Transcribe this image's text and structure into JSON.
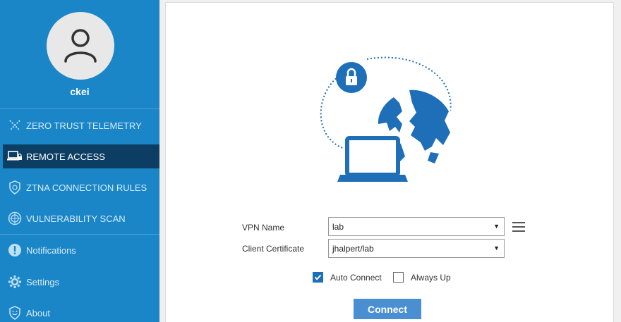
{
  "user": {
    "name": "ckei"
  },
  "nav": {
    "items": [
      {
        "label": "ZERO TRUST TELEMETRY",
        "icon": "telemetry-icon"
      },
      {
        "label": "REMOTE ACCESS",
        "icon": "laptop-lock-icon",
        "active": true
      },
      {
        "label": "ZTNA CONNECTION RULES",
        "icon": "shield-fingerprint-icon"
      },
      {
        "label": "VULNERABILITY SCAN",
        "icon": "radar-icon"
      },
      {
        "label": "Notifications",
        "icon": "exclamation-icon"
      },
      {
        "label": "Settings",
        "icon": "gear-icon"
      },
      {
        "label": "About",
        "icon": "shield-smile-icon"
      }
    ]
  },
  "form": {
    "vpn_name_label": "VPN Name",
    "vpn_name_value": "lab",
    "client_cert_label": "Client Certificate",
    "client_cert_value": "jhalpert/lab",
    "auto_connect_label": "Auto Connect",
    "auto_connect_checked": true,
    "always_up_label": "Always Up",
    "always_up_checked": false,
    "connect_label": "Connect"
  },
  "colors": {
    "sidebar": "#1a86c8",
    "active_nav": "#0c3d63",
    "accent": "#1e6fb8",
    "button": "#4a8fd2"
  }
}
